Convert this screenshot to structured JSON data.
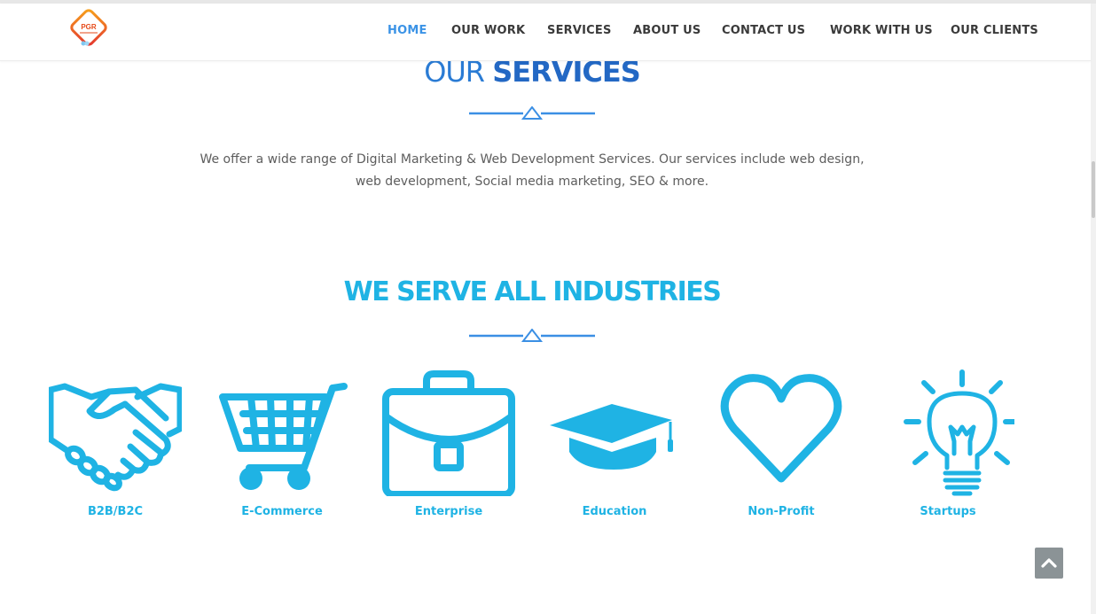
{
  "header": {
    "logo_text": "PGR",
    "nav": [
      {
        "label": "HOME",
        "active": true
      },
      {
        "label": "OUR WORK",
        "active": false
      },
      {
        "label": "SERVICES",
        "active": false
      },
      {
        "label": "ABOUT US",
        "active": false
      },
      {
        "label": "CONTACT US",
        "active": false
      },
      {
        "label": "WORK WITH US",
        "active": false
      },
      {
        "label": "OUR CLIENTS",
        "active": false
      }
    ]
  },
  "services": {
    "title_light": "OUR ",
    "title_bold": "SERVICES",
    "intro_line1": "We offer a wide range of Digital Marketing & Web Development Services. Our services include web design,",
    "intro_line2": "web development, Social media marketing, SEO & more."
  },
  "industries": {
    "title": "WE SERVE ALL INDUSTRIES",
    "items": [
      {
        "label": "B2B/B2C",
        "icon": "handshake-icon"
      },
      {
        "label": "E-Commerce",
        "icon": "shopping-cart-icon"
      },
      {
        "label": "Enterprise",
        "icon": "briefcase-icon"
      },
      {
        "label": "Education",
        "icon": "graduation-cap-icon"
      },
      {
        "label": "Non-Profit",
        "icon": "heart-icon"
      },
      {
        "label": "Startups",
        "icon": "lightbulb-icon"
      }
    ]
  },
  "colors": {
    "accent": "#1fb3e4",
    "nav_active": "#3b93e6",
    "services_title": "#2368c4",
    "divider": "#3b8fe4",
    "back_to_top": "#8b9396"
  }
}
